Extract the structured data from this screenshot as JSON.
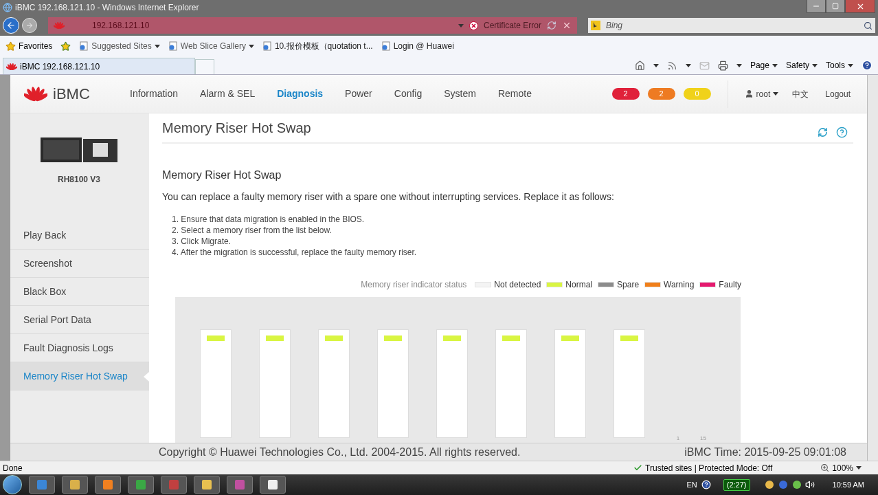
{
  "window": {
    "title": "iBMC 192.168.121.10 - Windows Internet Explorer"
  },
  "address_bar": {
    "url": "192.168.121.10",
    "certificate": "Certificate Error",
    "search_placeholder": "Bing"
  },
  "favorites_bar": {
    "label": "Favorites",
    "links": [
      {
        "label": "Suggested Sites",
        "dropdown": true
      },
      {
        "label": "Web Slice Gallery",
        "dropdown": true
      },
      {
        "label": "10.报价模板（quotation t...",
        "dropdown": false
      },
      {
        "label": "Login @ Huawei",
        "dropdown": false
      }
    ]
  },
  "tab": {
    "title": "iBMC 192.168.121.10"
  },
  "command_bar": [
    "Page",
    "Safety",
    "Tools"
  ],
  "header": {
    "product": "iBMC",
    "nav": [
      {
        "label": "Information",
        "selected": false
      },
      {
        "label": "Alarm & SEL",
        "selected": false
      },
      {
        "label": "Diagnosis",
        "selected": true
      },
      {
        "label": "Power",
        "selected": false
      },
      {
        "label": "Config",
        "selected": false
      },
      {
        "label": "System",
        "selected": false
      },
      {
        "label": "Remote",
        "selected": false
      }
    ],
    "alarm_badges": [
      {
        "count": "2",
        "color": "#e0213a"
      },
      {
        "count": "2",
        "color": "#ee7b22"
      },
      {
        "count": "0",
        "color": "#f0d21a"
      }
    ],
    "user": "root",
    "language": "中文",
    "logout": "Logout"
  },
  "sidebar": {
    "model": "RH8100 V3",
    "items": [
      {
        "label": "Play Back",
        "selected": false
      },
      {
        "label": "Screenshot",
        "selected": false
      },
      {
        "label": "Black Box",
        "selected": false
      },
      {
        "label": "Serial Port Data",
        "selected": false
      },
      {
        "label": "Fault Diagnosis Logs",
        "selected": false
      },
      {
        "label": "Memory Riser Hot Swap",
        "selected": true
      }
    ]
  },
  "main": {
    "title": "Memory Riser Hot Swap",
    "heading": "Memory Riser Hot Swap",
    "intro": "You can replace a faulty memory riser with a spare one without interrupting services. Replace it as follows:",
    "steps": [
      "1. Ensure that data migration is enabled in the BIOS.",
      "2. Select a memory riser from the list below.",
      "3. Click Migrate.",
      "4. After the migration is successful, replace the faulty memory riser."
    ],
    "legend": {
      "label": "Memory riser indicator status",
      "items": [
        {
          "label": "Not detected",
          "color": "#f4f4f4"
        },
        {
          "label": "Normal",
          "color": "#d9f542"
        },
        {
          "label": "Spare",
          "color": "#8c8c8c"
        },
        {
          "label": "Warning",
          "color": "#f07f1a"
        },
        {
          "label": "Faulty",
          "color": "#e5196e"
        }
      ]
    },
    "risers": [
      {
        "color": "#d9f542"
      },
      {
        "color": "#d9f542"
      },
      {
        "color": "#d9f542"
      },
      {
        "color": "#d9f542"
      },
      {
        "color": "#d9f542"
      },
      {
        "color": "#d9f542"
      },
      {
        "color": "#d9f542"
      },
      {
        "color": "#d9f542"
      }
    ],
    "scale_labels": [
      "1",
      "15"
    ]
  },
  "footer": {
    "copyright": "Copyright © Huawei Technologies Co., Ltd. 2004-2015. All rights reserved.",
    "time": "iBMC Time: 2015-09-25 09:01:08"
  },
  "status_bar": {
    "status": "Done",
    "zone": "Trusted sites | Protected Mode: Off",
    "zoom": "100%"
  },
  "taskbar": {
    "language": "EN",
    "battery": "(2:27)",
    "clock": "10:59 AM"
  }
}
